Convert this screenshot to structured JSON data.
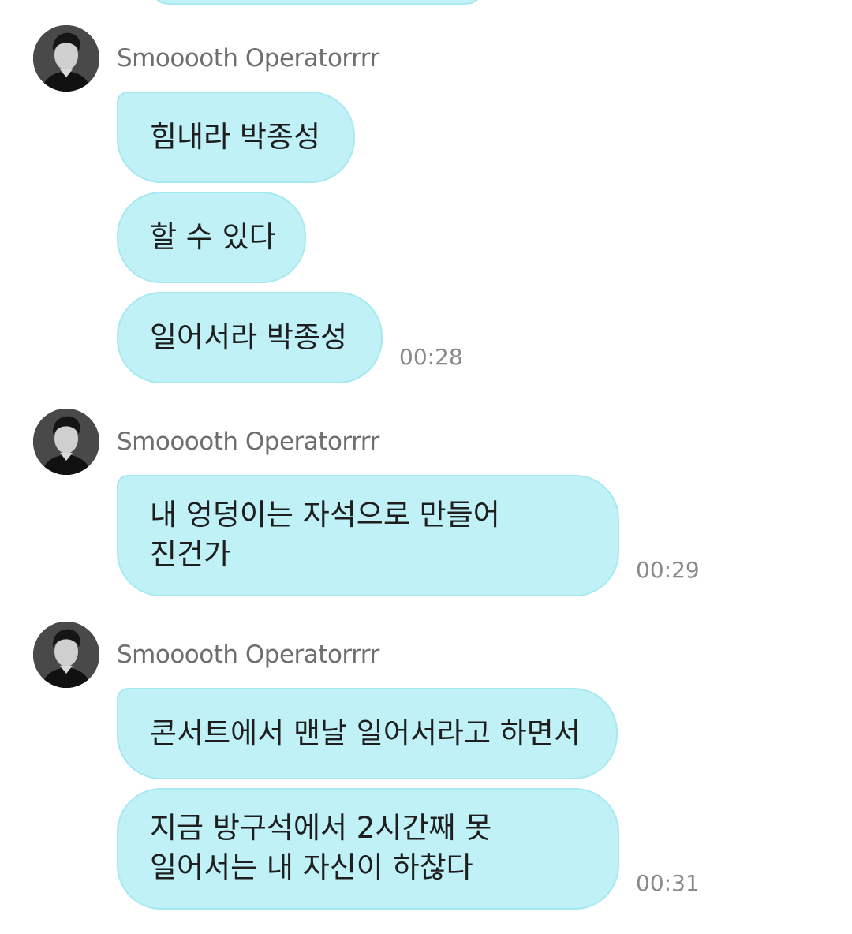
{
  "groups": [
    {
      "sender": "Smooooth Operatorrrr",
      "messages": [
        {
          "lines": [
            "힘내라 박종성"
          ]
        },
        {
          "lines": [
            "할 수 있다"
          ]
        },
        {
          "lines": [
            "일어서라 박종성"
          ]
        }
      ],
      "time": "00:28"
    },
    {
      "sender": "Smooooth Operatorrrr",
      "messages": [
        {
          "lines": [
            "내 엉덩이는 자석으로 만들어",
            "진건가"
          ]
        }
      ],
      "time": "00:29"
    },
    {
      "sender": "Smooooth Operatorrrr",
      "messages": [
        {
          "lines": [
            "콘서트에서 맨날 일어서라고 하면서"
          ]
        },
        {
          "lines": [
            "지금 방구석에서 2시간째 못",
            "일어서는 내 자신이 하찮다"
          ]
        }
      ],
      "time": "00:31"
    }
  ],
  "colors": {
    "bubble": "#bff1f6",
    "bubble_border": "#a8e9f0",
    "name": "#6e6e6e",
    "time": "#8a8a8a"
  },
  "icons": {
    "avatar": "profile-photo"
  }
}
